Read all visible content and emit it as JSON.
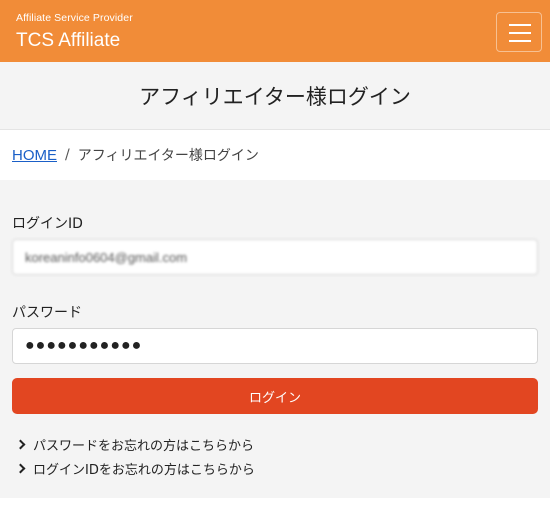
{
  "header": {
    "subtitle": "Affiliate Service Provider",
    "brand": "TCS Affiliate",
    "menu_icon": "hamburger-menu-icon",
    "color": "#f18c38"
  },
  "page": {
    "title": "アフィリエイター様ログイン"
  },
  "breadcrumb": {
    "home": "HOME",
    "separator": "/",
    "current": "アフィリエイター様ログイン"
  },
  "form": {
    "login_id_label": "ログインID",
    "login_id_value": "koreaninfo0604@gmail.com",
    "password_label": "パスワード",
    "password_value": "●●●●●●●●●●●",
    "submit_label": "ログイン",
    "submit_color": "#e24621"
  },
  "links": {
    "forgot_password": "パスワードをお忘れの方はこちらから",
    "forgot_login_id": "ログインIDをお忘れの方はこちらから",
    "icon": "chevron-right-icon"
  }
}
